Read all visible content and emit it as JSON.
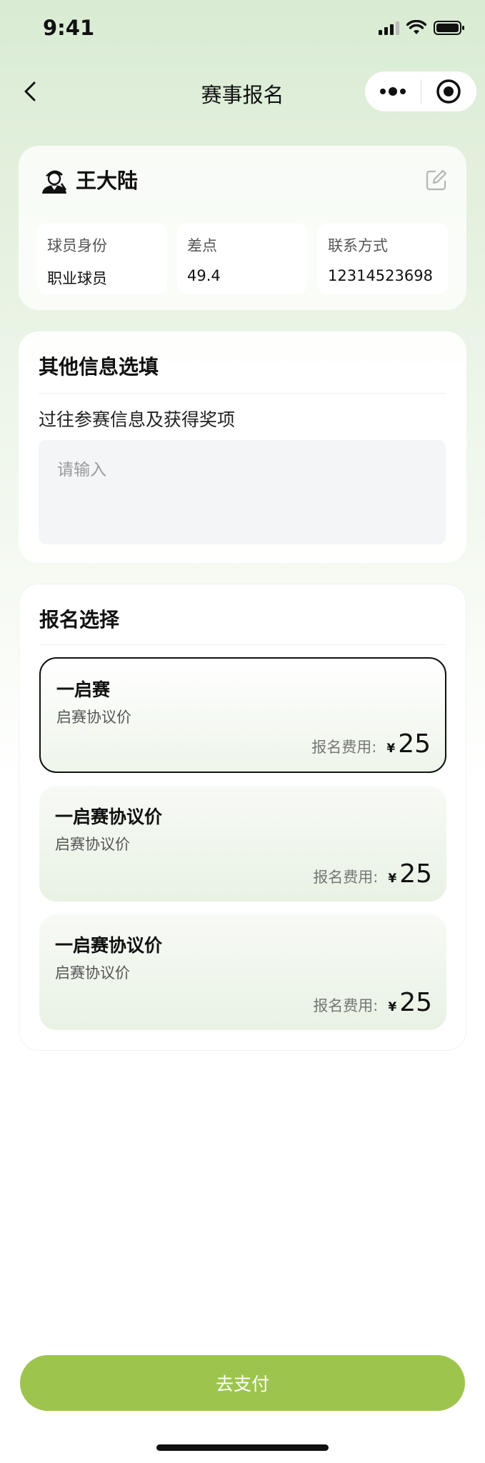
{
  "status_bar": {
    "time": "9:41"
  },
  "nav": {
    "title": "赛事报名"
  },
  "profile": {
    "name": "王大陆",
    "fields": [
      {
        "label": "球员身份",
        "value": "职业球员"
      },
      {
        "label": "差点",
        "value": "49.4"
      },
      {
        "label": "联系方式",
        "value": "12314523698"
      }
    ]
  },
  "other_info": {
    "title": "其他信息选填",
    "field_label": "过往参赛信息及获得奖项",
    "placeholder": "请输入"
  },
  "signup": {
    "title": "报名选择",
    "fee_label": "报名费用:",
    "currency": "¥",
    "options": [
      {
        "title": "一启赛",
        "subtitle": "启赛协议价",
        "amount": "25",
        "selected": true
      },
      {
        "title": "一启赛协议价",
        "subtitle": "启赛协议价",
        "amount": "25",
        "selected": false
      },
      {
        "title": "一启赛协议价",
        "subtitle": "启赛协议价",
        "amount": "25",
        "selected": false
      }
    ]
  },
  "pay_button": {
    "label": "去支付"
  },
  "colors": {
    "accent": "#9dc54d",
    "selected_border": "#111111"
  }
}
